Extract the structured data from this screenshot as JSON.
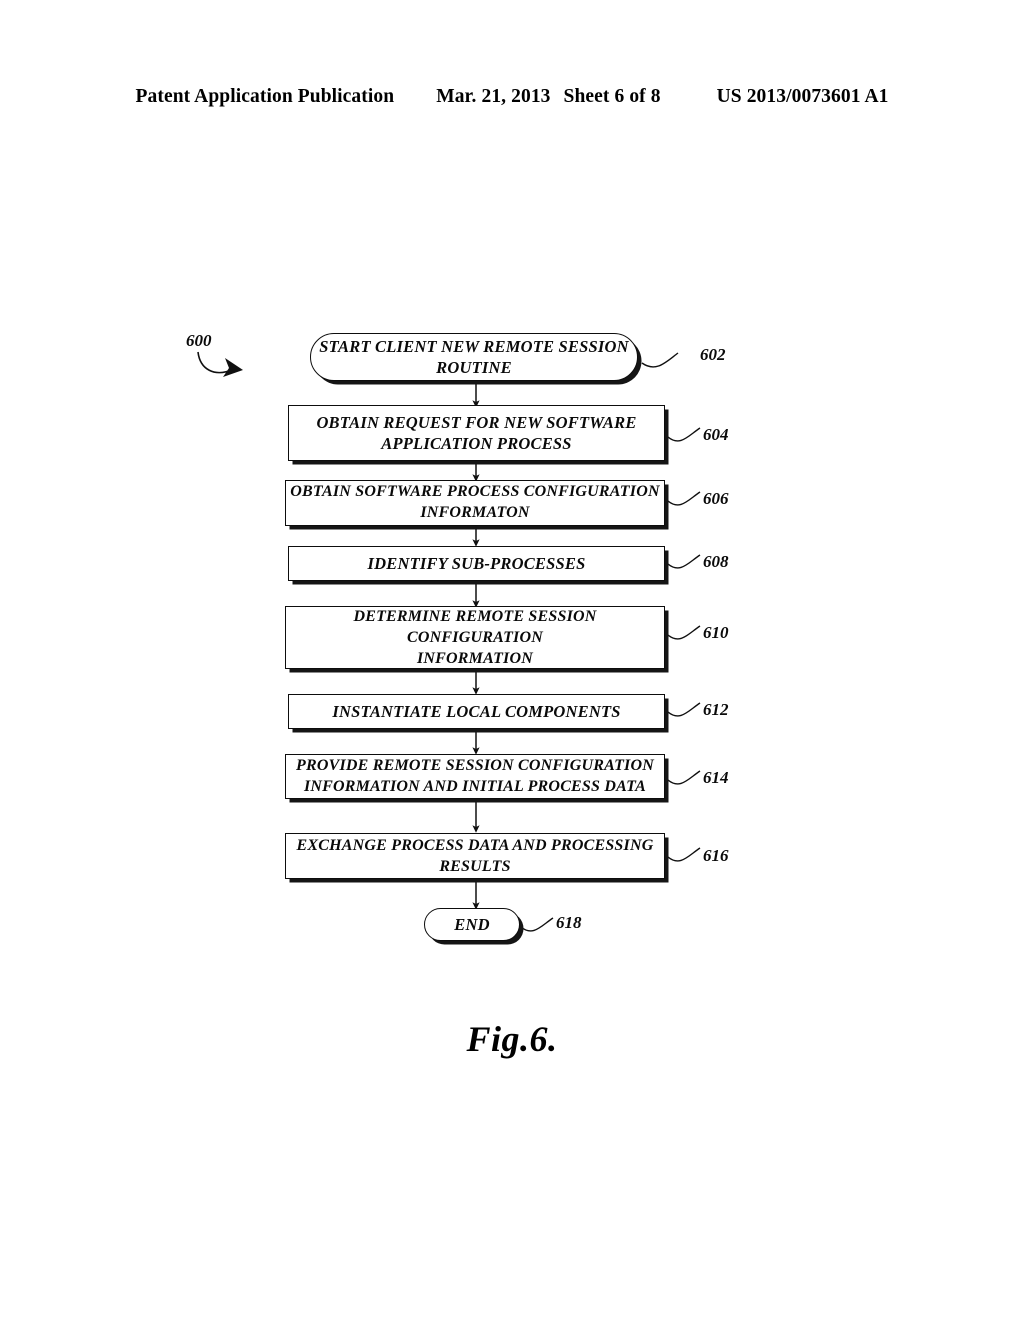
{
  "header": {
    "publication": "Patent Application Publication",
    "date": "Mar. 21, 2013",
    "sheet": "Sheet 6 of 8",
    "patent_number": "US 2013/0073601 A1"
  },
  "figure": {
    "caption": "Fig.6.",
    "diagram_label": "600"
  },
  "flowchart": {
    "nodes": [
      {
        "ref": "602",
        "shape": "terminator",
        "lines": [
          "START CLIENT NEW REMOTE SESSION",
          "ROUTINE"
        ],
        "text": "START CLIENT NEW REMOTE SESSION ROUTINE"
      },
      {
        "ref": "604",
        "shape": "process",
        "lines": [
          "OBTAIN REQUEST FOR NEW SOFTWARE",
          "APPLICATION PROCESS"
        ],
        "text": "OBTAIN REQUEST FOR NEW SOFTWARE APPLICATION PROCESS"
      },
      {
        "ref": "606",
        "shape": "process",
        "lines": [
          "OBTAIN SOFTWARE PROCESS CONFIGURATION",
          "INFORMATON"
        ],
        "text": "OBTAIN SOFTWARE PROCESS CONFIGURATION INFORMATON"
      },
      {
        "ref": "608",
        "shape": "process",
        "lines": [
          "IDENTIFY SUB-PROCESSES"
        ],
        "text": "IDENTIFY SUB-PROCESSES"
      },
      {
        "ref": "610",
        "shape": "process",
        "lines": [
          "DETERMINE REMOTE SESSION CONFIGURATION",
          "INFORMATION"
        ],
        "text": "DETERMINE REMOTE SESSION CONFIGURATION INFORMATION"
      },
      {
        "ref": "612",
        "shape": "process",
        "lines": [
          "INSTANTIATE LOCAL COMPONENTS"
        ],
        "text": "INSTANTIATE LOCAL COMPONENTS"
      },
      {
        "ref": "614",
        "shape": "process",
        "lines": [
          "PROVIDE REMOTE SESSION CONFIGURATION",
          "INFORMATION AND INITIAL PROCESS DATA"
        ],
        "text": "PROVIDE REMOTE SESSION CONFIGURATION INFORMATION AND INITIAL PROCESS DATA"
      },
      {
        "ref": "616",
        "shape": "process",
        "lines": [
          "EXCHANGE PROCESS DATA AND PROCESSING",
          "RESULTS"
        ],
        "text": "EXCHANGE PROCESS DATA AND PROCESSING RESULTS"
      },
      {
        "ref": "618",
        "shape": "terminator",
        "lines": [
          "END"
        ],
        "text": "END"
      }
    ]
  }
}
